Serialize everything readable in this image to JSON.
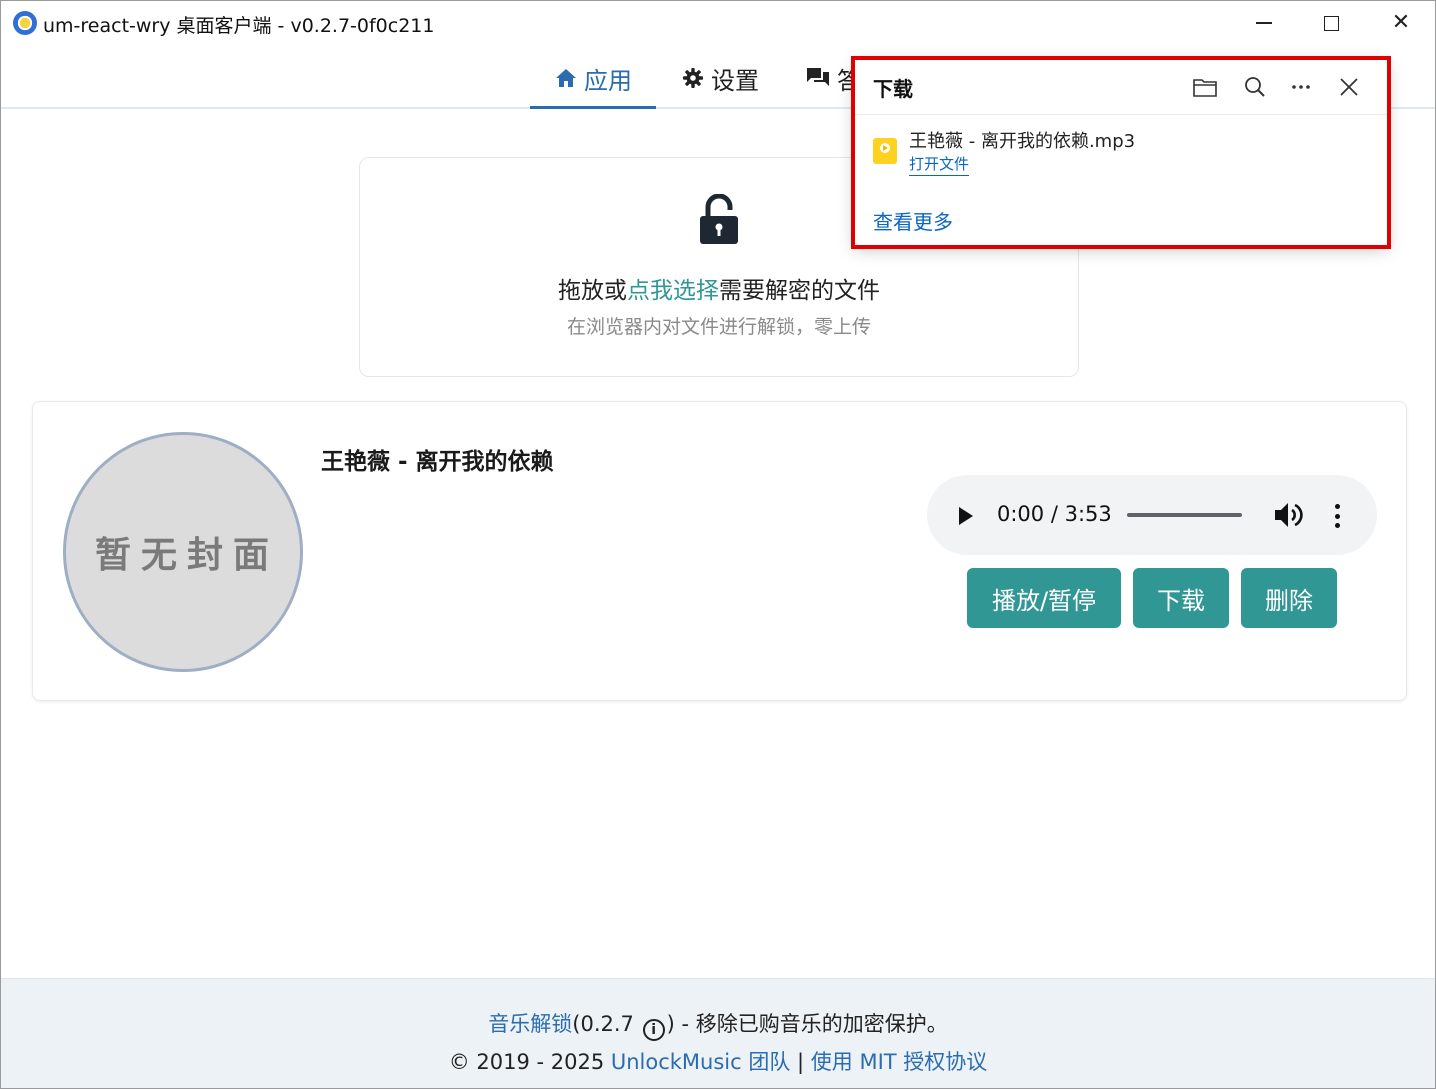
{
  "window": {
    "title": "um-react-wry 桌面客户端 - v0.2.7-0f0c211"
  },
  "tabs": [
    {
      "label": "应用",
      "icon": "home-icon",
      "active": true
    },
    {
      "label": "设置",
      "icon": "gear-icon",
      "active": false
    },
    {
      "label": "答",
      "icon": "chat-icon",
      "active": false
    }
  ],
  "dropzone": {
    "prefix": "拖放或",
    "link": "点我选择",
    "suffix": "需要解密的文件",
    "subtitle": "在浏览器内对文件进行解锁，零上传"
  },
  "song": {
    "cover_placeholder": "暂无封面",
    "title": "王艳薇 - 离开我的依赖",
    "player": {
      "time": "0:00 / 3:53",
      "progress": 0
    },
    "buttons": {
      "play": "播放/暂停",
      "download": "下载",
      "delete": "删除"
    }
  },
  "footer": {
    "app_link": "音乐解锁",
    "version": "(0.2.7",
    "version_close": ")",
    "description": " - 移除已购音乐的加密保护。",
    "copyright": "© 2019 - 2025 ",
    "team_link": "UnlockMusic 团队",
    "separator": " | ",
    "license_link": "使用 MIT 授权协议"
  },
  "downloads": {
    "title": "下载",
    "item": {
      "filename": "王艳薇 - 离开我的依赖.mp3",
      "open_label": "打开文件"
    },
    "see_more": "查看更多"
  },
  "colors": {
    "accent": "#319795",
    "tab_active": "#2b6cb0",
    "highlight": "#e00000"
  }
}
